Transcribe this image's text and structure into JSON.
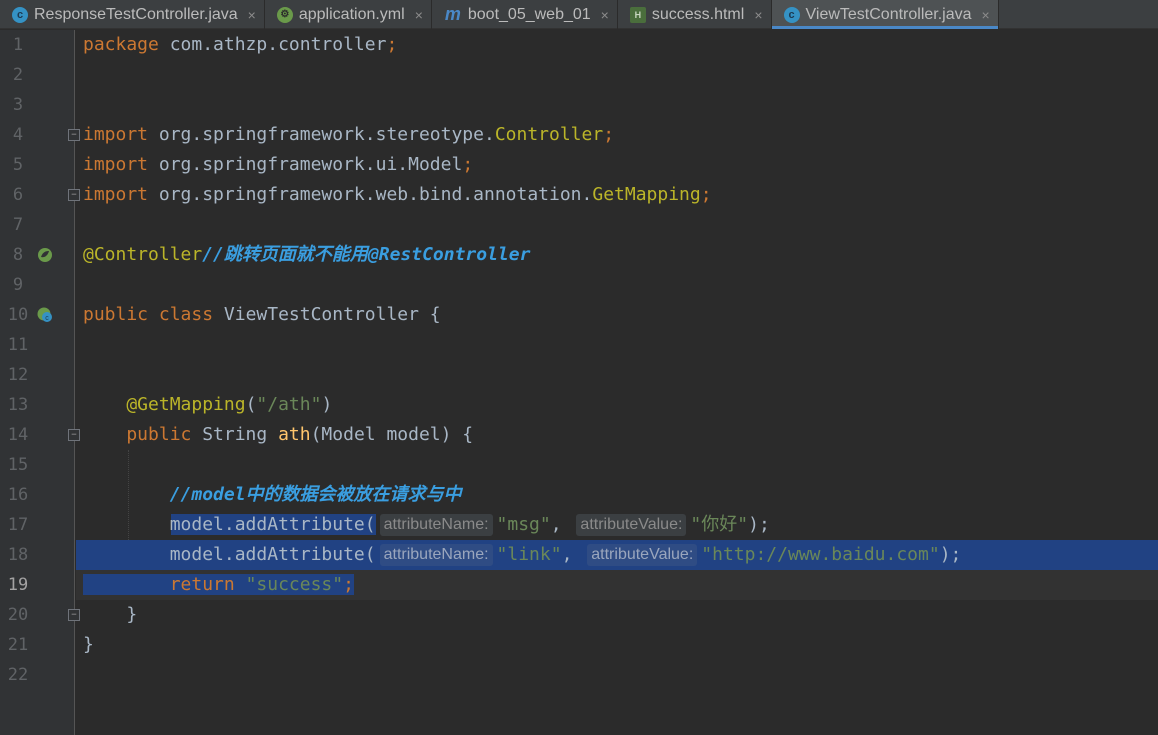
{
  "tabs": [
    {
      "label": "ResponseTestController.java",
      "icon": "java-class-icon",
      "active": false
    },
    {
      "label": "application.yml",
      "icon": "spring-yml-icon",
      "active": false
    },
    {
      "label": "boot_05_web_01",
      "icon": "maven-icon",
      "active": false
    },
    {
      "label": "success.html",
      "icon": "html-file-icon",
      "active": false
    },
    {
      "label": "ViewTestController.java",
      "icon": "java-class-icon",
      "active": true
    }
  ],
  "close_glyph": "×",
  "line_numbers": [
    "1",
    "2",
    "3",
    "4",
    "5",
    "6",
    "7",
    "8",
    "9",
    "10",
    "11",
    "12",
    "13",
    "14",
    "15",
    "16",
    "17",
    "18",
    "19",
    "20",
    "21",
    "22"
  ],
  "current_line": "19",
  "code": {
    "l1": {
      "kw": "package",
      "text": " com.athzp.controller",
      "semi": ";"
    },
    "l4": {
      "kw": "import",
      "pkg": " org.springframework.stereotype.",
      "cls": "Controller",
      "semi": ";"
    },
    "l5": {
      "kw": "import",
      "pkg": " org.springframework.ui.Model",
      "semi": ";"
    },
    "l6": {
      "kw": "import",
      "pkg": " org.springframework.web.bind.annotation.",
      "cls": "GetMapping",
      "semi": ";"
    },
    "l8": {
      "ann": "@Controller",
      "comment": "//跳转页面就不能用@RestController"
    },
    "l10": {
      "kw1": "public",
      "kw2": " class",
      "text": " ViewTestController {"
    },
    "l13": {
      "ann": "    @GetMapping",
      "open": "(",
      "str": "\"/ath\"",
      "close": ")"
    },
    "l14": {
      "kw": "    public",
      "text1": " String ",
      "fn": "ath",
      "text2": "(Model model) {"
    },
    "l16": {
      "comment": "        //model中的数据会被放在请求与中"
    },
    "l17": {
      "text1": "        model.addAttribute(",
      "hint1": "attributeName:",
      "str1": "\"msg\"",
      "sep": ", ",
      "hint2": "attributeValue:",
      "str2": "\"你好\"",
      "end": ");"
    },
    "l18": {
      "text1": "        model.addAttribute(",
      "hint1": "attributeName:",
      "str1": "\"link\"",
      "sep": ", ",
      "hint2": "attributeValue:",
      "str2": "\"http://www.baidu.com\"",
      "end": ");"
    },
    "l19": {
      "indent": "        ",
      "kw": "return",
      "str": " \"success\"",
      "semi": ";"
    },
    "l20": {
      "text": "    }"
    },
    "l21": {
      "text": "}"
    }
  },
  "colors": {
    "selection": "#214283",
    "keyword": "#cc7832",
    "annotation": "#bbb529",
    "string": "#6a8759",
    "comment": "#3a9ee0"
  }
}
